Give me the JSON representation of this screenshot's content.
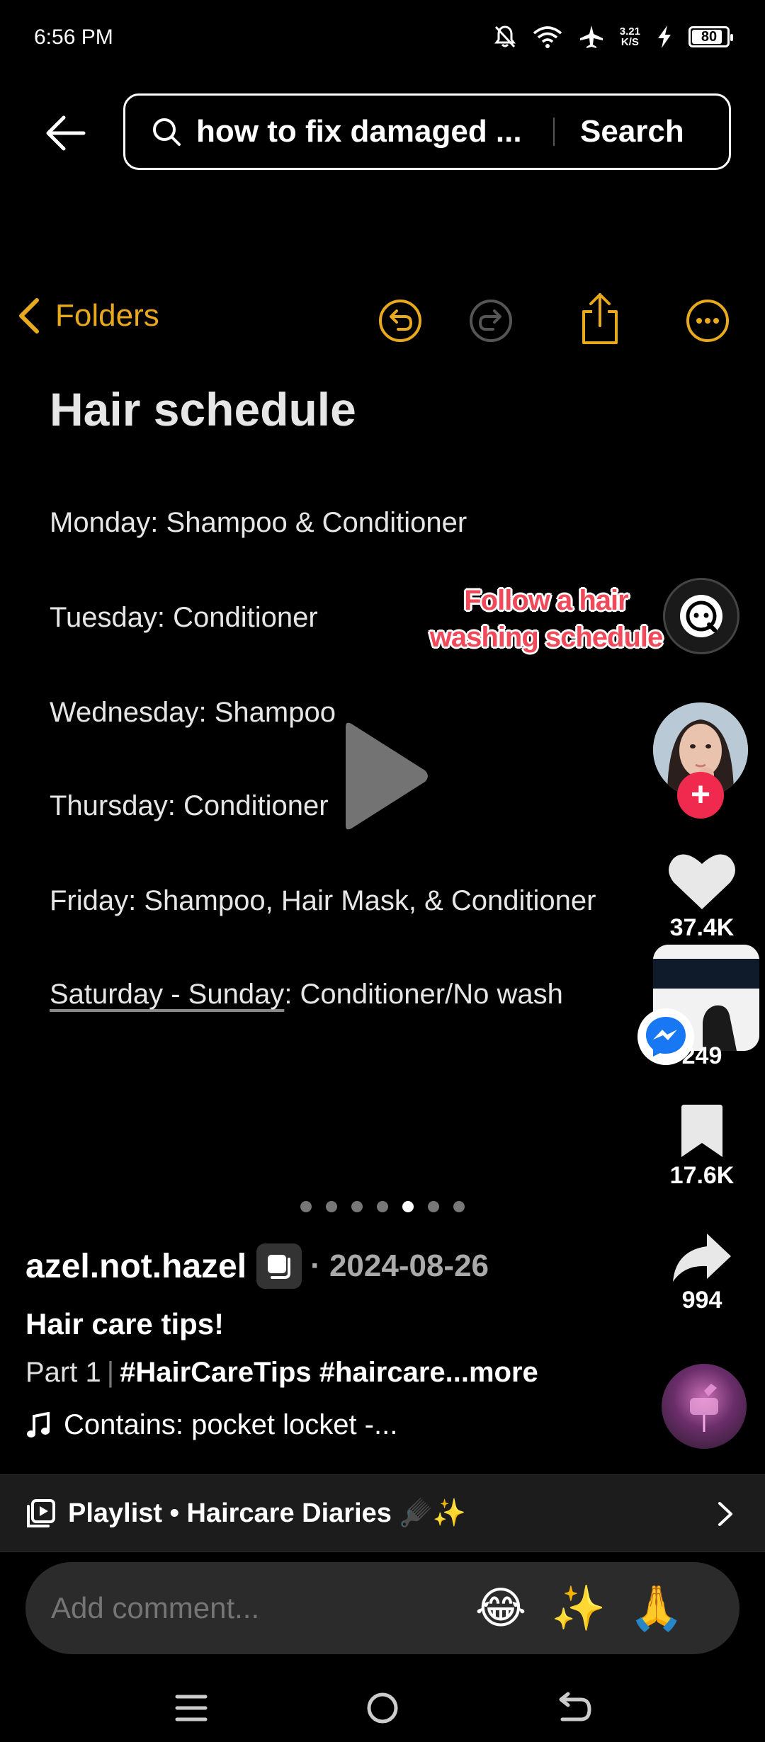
{
  "status_bar": {
    "time": "6:56 PM",
    "net_speed_value": "3.21",
    "net_speed_unit": "K/S",
    "battery": "80",
    "battery_level_percent": 80
  },
  "search": {
    "query": "how to fix damaged ...",
    "submit_label": "Search"
  },
  "notes": {
    "back_label": "Folders",
    "title": "Hair schedule",
    "lines": [
      "Monday: Shampoo & Conditioner",
      "Tuesday: Conditioner",
      "Wednesday: Shampoo",
      "Thursday: Conditioner",
      "Friday: Shampoo, Hair Mask, & Conditioner"
    ],
    "last_line_underlined": "Saturday - Sunday",
    "last_line_rest": ": Conditioner/No wash"
  },
  "overlay": {
    "line1": "Follow a hair",
    "line2": "washing schedule"
  },
  "actions": {
    "likes": "37.4K",
    "comments": "249",
    "saves": "17.6K",
    "shares": "994"
  },
  "carousel": {
    "count": 7,
    "active_index": 4
  },
  "post": {
    "author": "azel.not.hazel",
    "date": "· 2024-08-26",
    "title": "Hair care tips!",
    "part": "Part 1",
    "divider": "|",
    "hashtags": "#HairCareTips #haircare",
    "more": "...more",
    "music": "Contains: pocket locket -..."
  },
  "playlist": {
    "label": "Playlist • Haircare Diaries 🪮✨"
  },
  "comment": {
    "placeholder": "Add comment...",
    "emojis": [
      "😂",
      "✨",
      "🙏"
    ]
  },
  "icons": {
    "back": "arrow-left-icon",
    "search": "search-icon",
    "undo": "undo-icon",
    "redo": "redo-icon",
    "share_note": "share-icon",
    "more": "more-icon",
    "like": "heart-icon",
    "save": "bookmark-icon",
    "share": "share-arrow-icon"
  },
  "colors": {
    "notes_accent": "#e8a91d",
    "follow_red": "#f0294f",
    "overlay_red": "#f04a5a",
    "messenger_blue": "#1877f2"
  }
}
